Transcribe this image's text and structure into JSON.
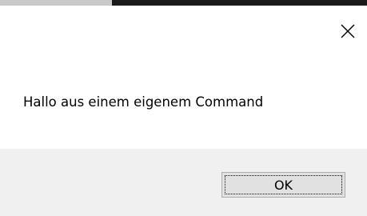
{
  "dialog": {
    "message": "Hallo aus einem eigenem Command",
    "ok_label": "OK",
    "close_icon": "close-icon"
  }
}
